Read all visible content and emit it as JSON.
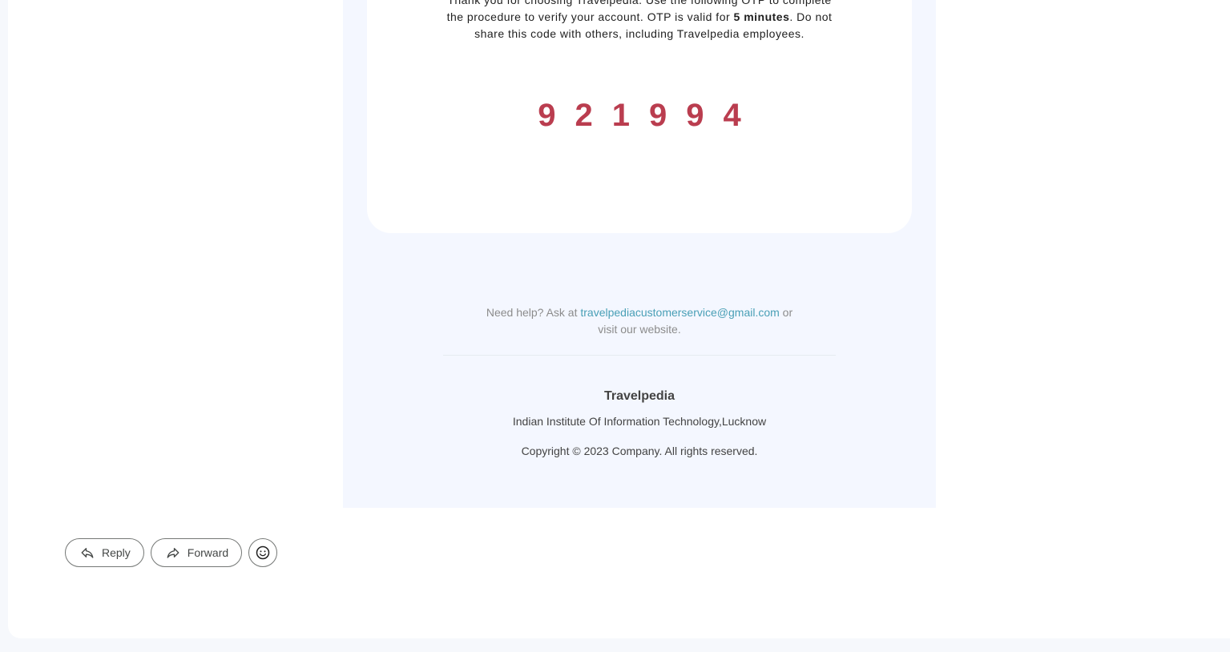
{
  "email": {
    "intro_line1": "Thank you for choosing Travelpedia. Use the following OTP to complete",
    "intro_line2_start": "the procedure to verify your account. OTP is valid for ",
    "intro_bold": "5 minutes",
    "intro_line2_end": ". Do not",
    "intro_line3": "share this code with others, including Travelpedia employees.",
    "otp": "921994",
    "help_prefix": "Need help? Ask at ",
    "help_email": "travelpediacustomerservice@gmail.com",
    "help_suffix_or": " or",
    "help_suffix": "visit our website.",
    "company_name": "Travelpedia",
    "company_address": "Indian Institute Of Information Technology,Lucknow",
    "copyright": "Copyright © 2023 Company. All rights reserved.",
    "colors": {
      "otp": "#ba3d4f",
      "link": "#499fb6",
      "canvas": "#f4f7ff"
    }
  },
  "actions": {
    "reply_label": "Reply",
    "forward_label": "Forward",
    "reply_icon": "reply-icon",
    "forward_icon": "forward-icon",
    "emoji_icon": "emoji-smile-icon"
  }
}
